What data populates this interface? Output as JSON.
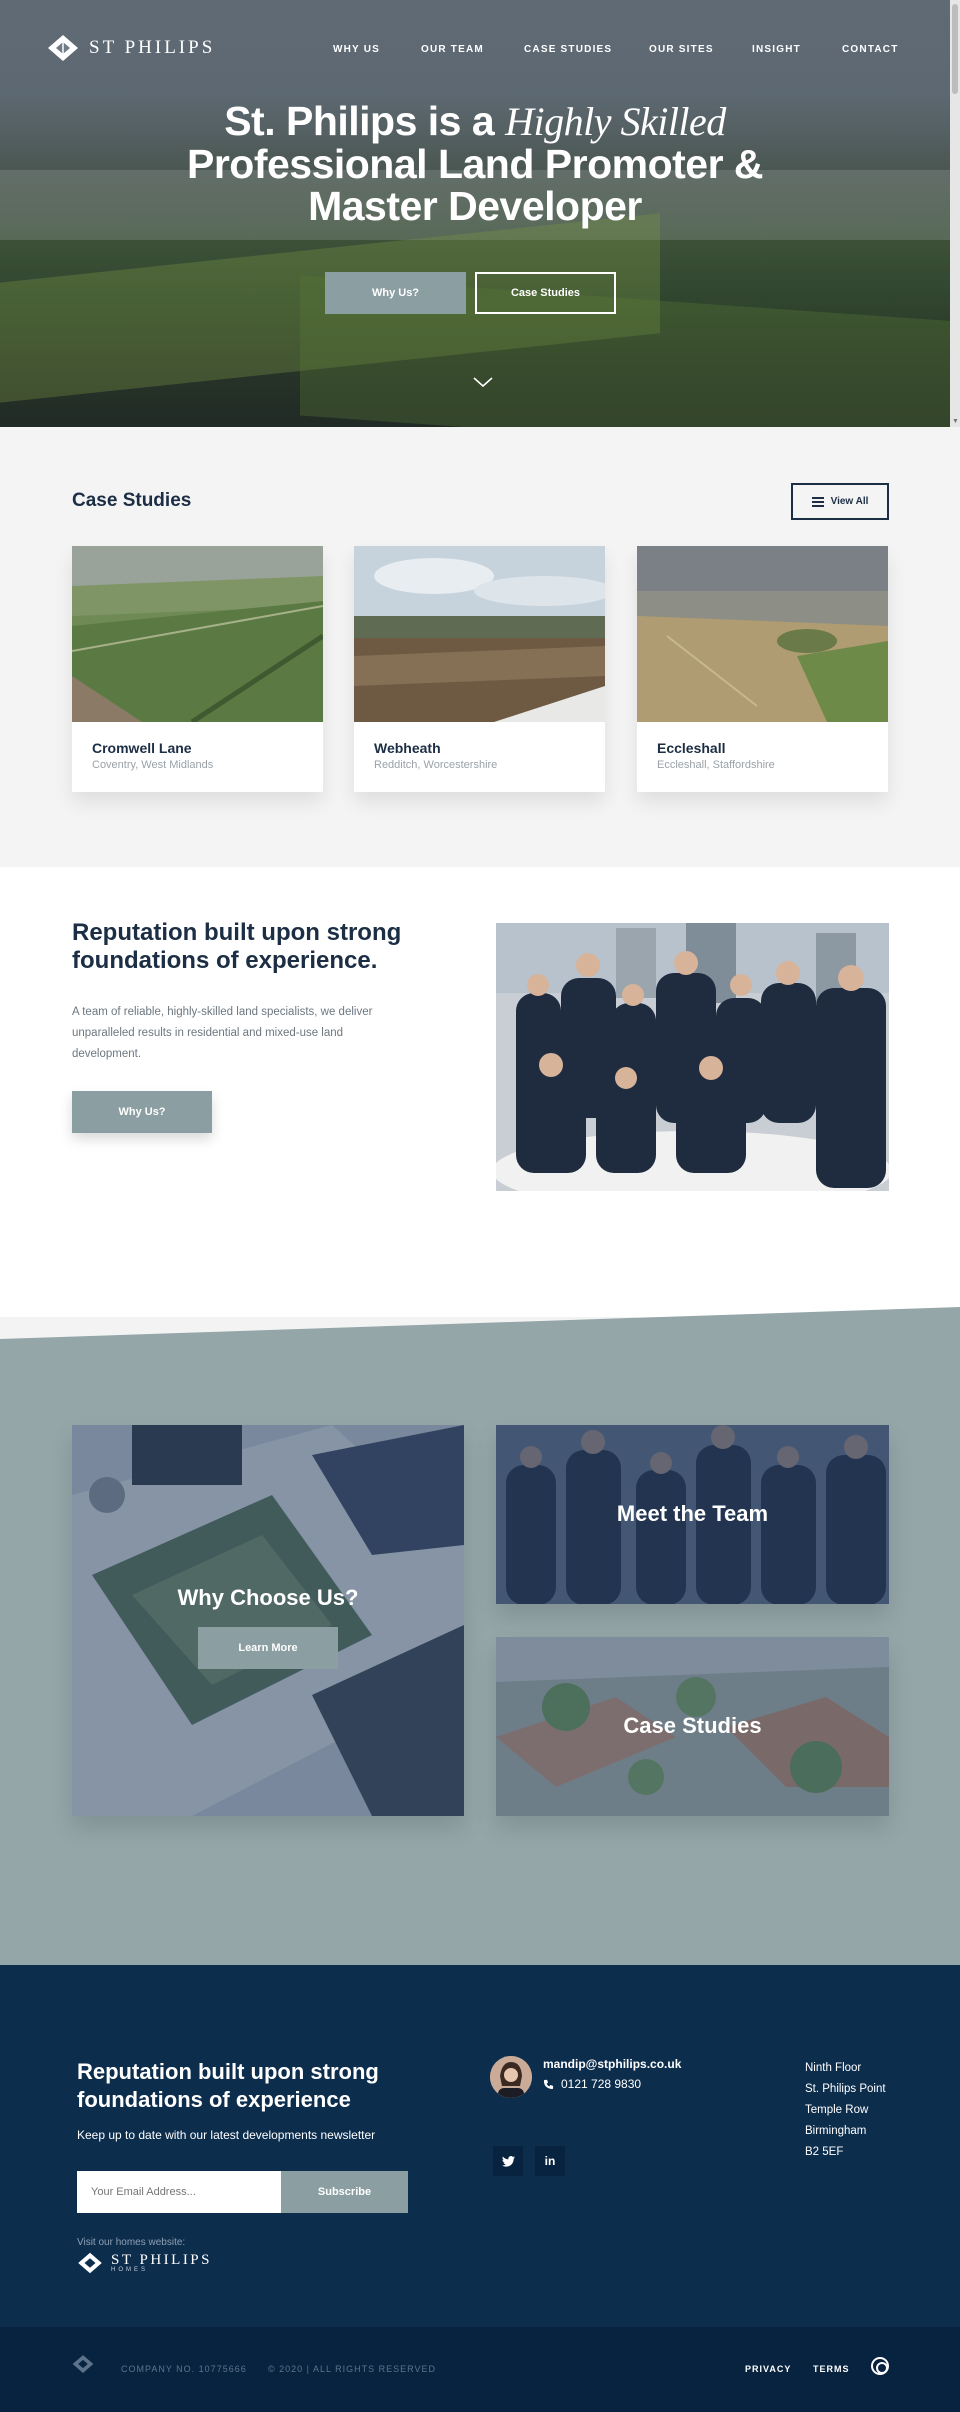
{
  "brand": {
    "logo_text": "ST PHILIPS"
  },
  "nav": [
    "WHY US",
    "OUR TEAM",
    "CASE STUDIES",
    "OUR SITES",
    "INSIGHT",
    "CONTACT"
  ],
  "hero": {
    "title_line1_a": "St. Philips is a ",
    "title_line1_b": "Highly Skilled",
    "title_line2": "Professional Land Promoter &",
    "title_line3": "Master Developer",
    "btn_primary": "Why Us?",
    "btn_secondary": "Case Studies"
  },
  "case_studies": {
    "title": "Case Studies",
    "view_all": "View All",
    "cards": [
      {
        "name": "Cromwell Lane",
        "location": "Coventry, West Midlands"
      },
      {
        "name": "Webheath",
        "location": "Redditch, Worcestershire"
      },
      {
        "name": "Eccleshall",
        "location": "Eccleshall, Staffordshire"
      }
    ]
  },
  "reputation": {
    "heading": "Reputation built upon strong foundations of experience.",
    "body": "A team of reliable, highly-skilled land specialists, we deliver unparalleled results in residential and mixed-use land development.",
    "button": "Why Us?"
  },
  "tiles": {
    "why": {
      "title": "Why Choose Us?",
      "button": "Learn More"
    },
    "team": {
      "title": "Meet the Team"
    },
    "cases": {
      "title": "Case Studies"
    }
  },
  "footer": {
    "heading": "Reputation built upon strong foundations of experience",
    "subtext": "Keep up to date with our latest developments newsletter",
    "email_placeholder": "Your Email Address...",
    "subscribe": "Subscribe",
    "visit": "Visit our homes website:",
    "homes_logo_text": "ST PHILIPS",
    "homes_logo_sub": "HOMES",
    "contact_email": "mandip@stphilips.co.uk",
    "contact_phone": "0121 728 9830",
    "social": [
      "twitter",
      "linkedin"
    ],
    "address": [
      "Ninth Floor",
      "St. Philips Point",
      "Temple Row",
      "Birmingham",
      "B2 5EF"
    ]
  },
  "bottombar": {
    "company_no": "COMPANY NO. 10775666",
    "rights": "© 2020 | ALL RIGHTS RESERVED",
    "privacy": "PRIVACY",
    "terms": "TERMS"
  },
  "colors": {
    "navy": "#0d2d4d",
    "sage": "#8b9ea1",
    "slate": "#94a6a8"
  }
}
